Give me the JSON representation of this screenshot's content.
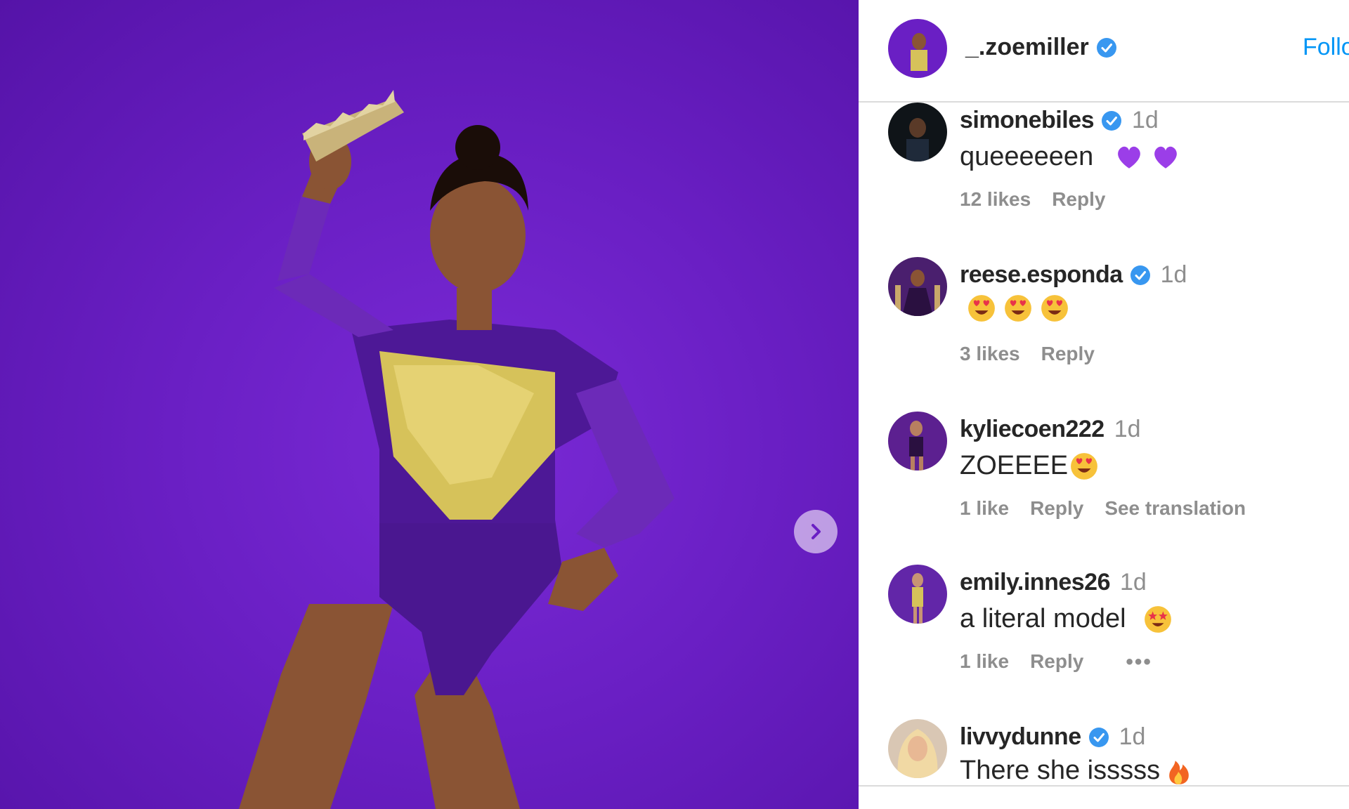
{
  "post": {
    "owner": "_.zoemiller",
    "follow_label": "Follo",
    "owner_verified": true,
    "next_icon": "chevron-right-icon"
  },
  "comments": [
    {
      "user": "simonebiles",
      "verified": true,
      "time": "1d",
      "text": "queeeeeen",
      "emojis": [
        "purple-heart",
        "purple-heart"
      ],
      "likes": "12 likes",
      "reply": "Reply"
    },
    {
      "user": "reese.esponda",
      "verified": true,
      "time": "1d",
      "text": "",
      "emojis": [
        "heart-eyes",
        "heart-eyes",
        "heart-eyes"
      ],
      "likes": "3 likes",
      "reply": "Reply"
    },
    {
      "user": "kyliecoen222",
      "verified": false,
      "time": "1d",
      "text": "ZOEEEE",
      "emojis": [
        "heart-eyes"
      ],
      "likes": "1 like",
      "reply": "Reply",
      "translate": "See translation"
    },
    {
      "user": "emily.innes26",
      "verified": false,
      "time": "1d",
      "text": "a literal model",
      "emojis": [
        "star-eyes"
      ],
      "likes": "1 like",
      "reply": "Reply",
      "more": "•••"
    },
    {
      "user": "livvydunne",
      "verified": true,
      "time": "1d",
      "text": "There she isssss",
      "emojis": [
        "fire"
      ]
    }
  ],
  "colors": {
    "background_purple": "#6a1fc4",
    "link_blue": "#0095f6",
    "verified_blue": "#3897f0",
    "muted_gray": "#8e8e8e"
  }
}
